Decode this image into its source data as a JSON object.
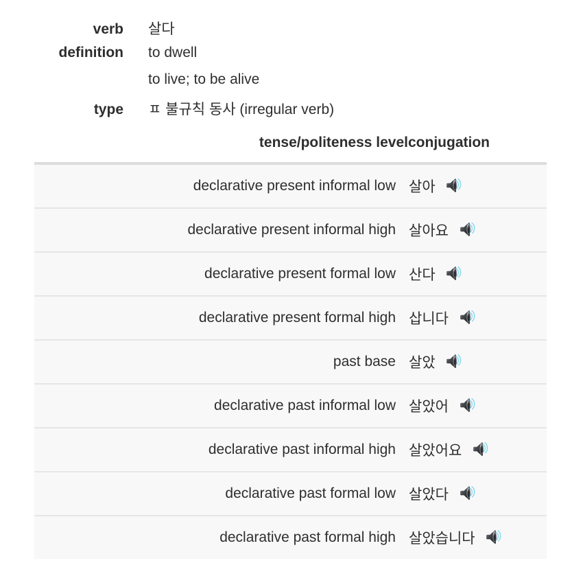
{
  "entry": {
    "rows": [
      {
        "label": "verb",
        "value": "살다"
      },
      {
        "label": "definition",
        "value": "to dwell"
      },
      {
        "label": "",
        "value": "to live; to be alive"
      },
      {
        "label": "type",
        "value": "ㅍ 불규칙 동사 (irregular verb)"
      }
    ]
  },
  "table": {
    "headers": {
      "tense": "tense/politeness level",
      "conjugation": "conjugation"
    },
    "audio_icon_name": "speaker-icon",
    "rows": [
      {
        "tense": "declarative present informal low",
        "conjugation": "살아"
      },
      {
        "tense": "declarative present informal high",
        "conjugation": "살아요"
      },
      {
        "tense": "declarative present formal low",
        "conjugation": "산다"
      },
      {
        "tense": "declarative present formal high",
        "conjugation": "삽니다"
      },
      {
        "tense": "past base",
        "conjugation": "살았"
      },
      {
        "tense": "declarative past informal low",
        "conjugation": "살았어"
      },
      {
        "tense": "declarative past informal high",
        "conjugation": "살았어요"
      },
      {
        "tense": "declarative past formal low",
        "conjugation": "살았다"
      },
      {
        "tense": "declarative past formal high",
        "conjugation": "살았습니다"
      }
    ]
  },
  "colors": {
    "text": "#2e2e2e",
    "page_background": "#ffffff",
    "table_row_background": "#f8f8f8",
    "table_top_border": "#dcdcdc",
    "table_row_border": "#e6e6e6",
    "speaker_body": "#3a3a3a",
    "speaker_wave": "#7fd8ee"
  }
}
